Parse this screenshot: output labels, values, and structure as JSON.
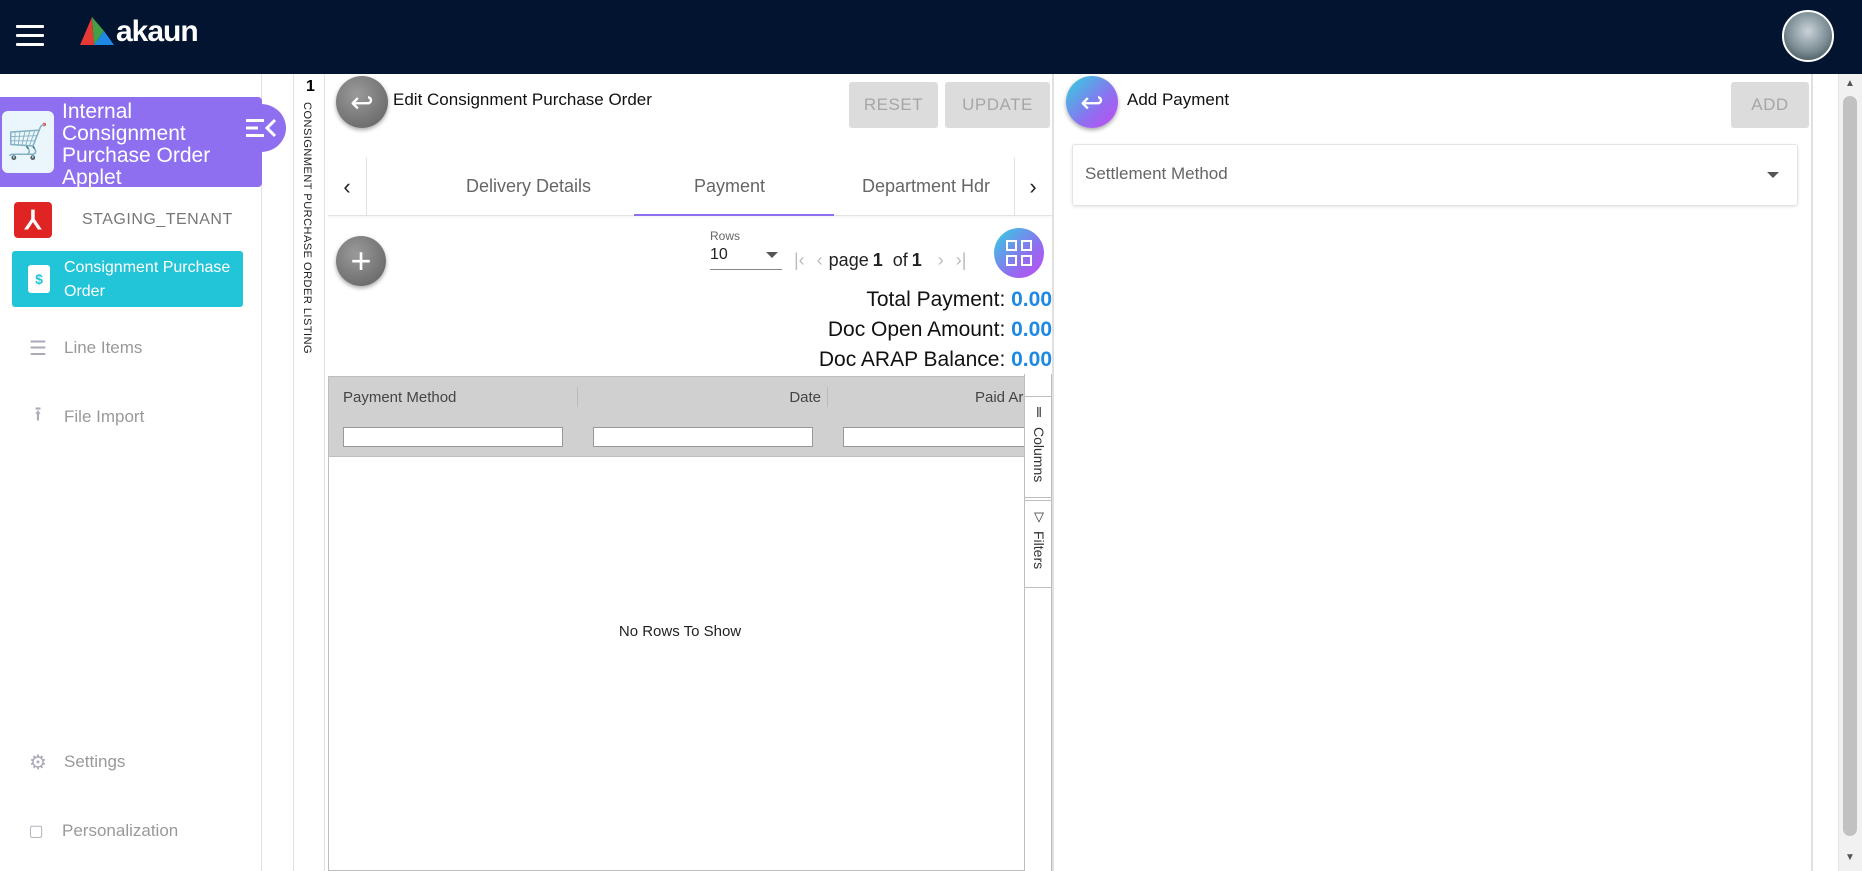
{
  "app": {
    "brand": "akaun"
  },
  "sidebar": {
    "applet_title": "Internal Consignment Purchase Order Applet",
    "tenant": "STAGING_TENANT",
    "items": [
      {
        "label": "Consignment Purchase Order",
        "active": true
      },
      {
        "label": "Line Items"
      },
      {
        "label": "File Import"
      },
      {
        "label": "Settings"
      },
      {
        "label": "Personalization"
      }
    ]
  },
  "listing_strip": {
    "count": "1",
    "label": "CONSIGNMENT PURCHASE ORDER LISTING"
  },
  "edit_panel": {
    "title": "Edit Consignment Purchase Order",
    "reset_label": "RESET",
    "update_label": "UPDATE",
    "tabs": [
      "Delivery Details",
      "Payment",
      "Department Hdr"
    ],
    "active_tab": "Payment",
    "rows_label": "Rows",
    "rows_value": "10",
    "pager": {
      "page_word": "page",
      "page": "1",
      "of_word": "of",
      "total": "1"
    },
    "totals": [
      {
        "label": "Total Payment:",
        "value": "0.00"
      },
      {
        "label": "Doc Open Amount:",
        "value": "0.00"
      },
      {
        "label": "Doc ARAP Balance:",
        "value": "0.00"
      }
    ],
    "grid": {
      "columns": [
        "Payment Method",
        "Date",
        "Paid Ar"
      ],
      "empty_text": "No Rows To Show",
      "side_tabs": [
        "Columns",
        "Filters"
      ]
    }
  },
  "payment_panel": {
    "title": "Add Payment",
    "add_label": "ADD",
    "settlement_placeholder": "Settlement Method"
  }
}
